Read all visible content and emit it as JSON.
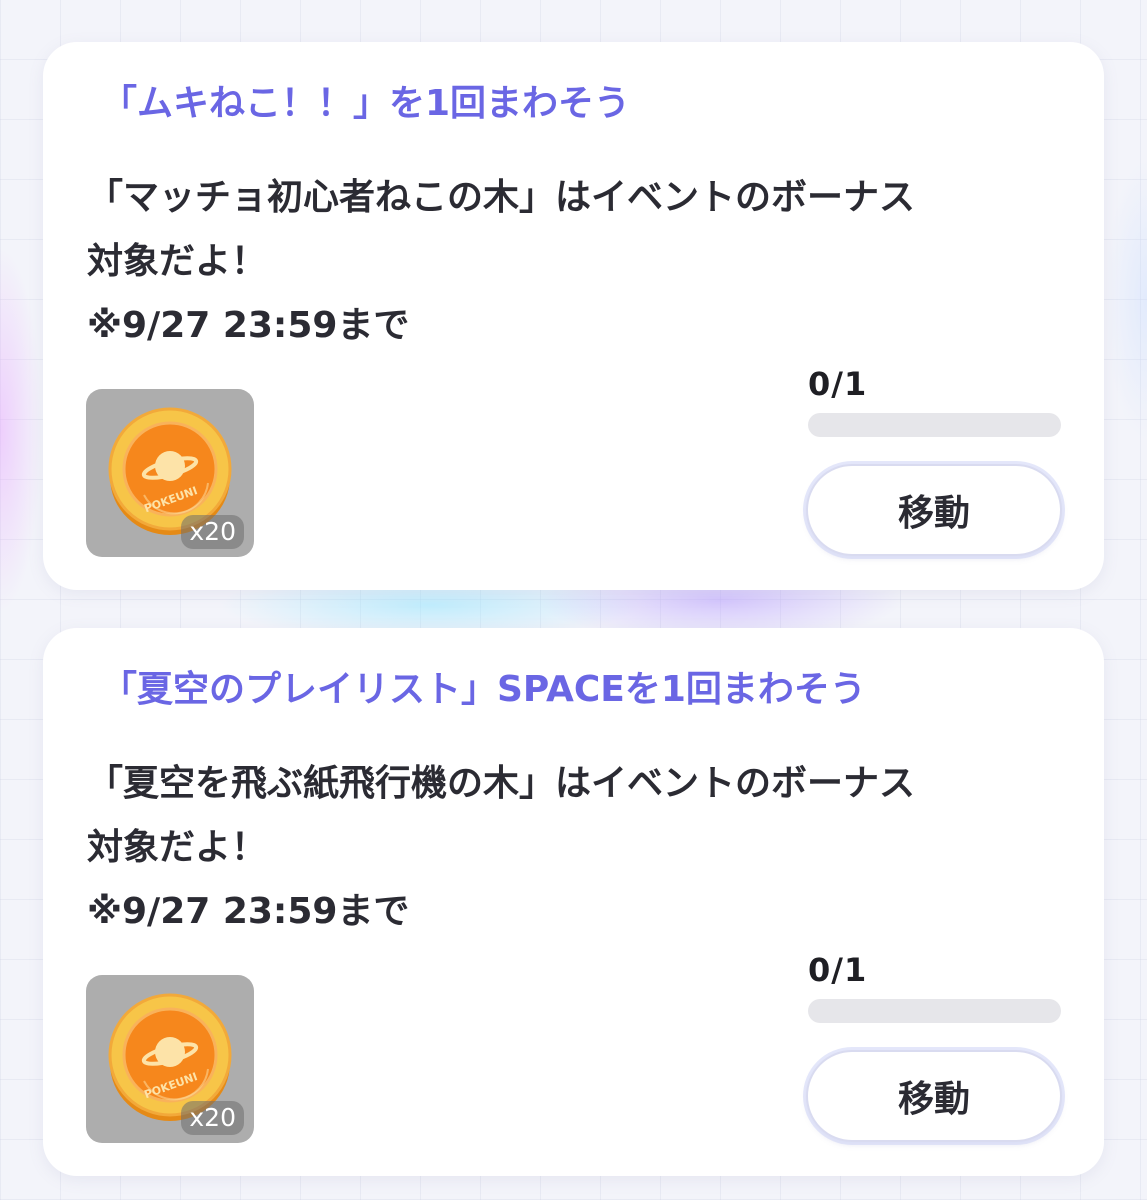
{
  "missions": [
    {
      "title": "「ムキねこ！！」を1回まわそう",
      "description_lines": [
        "「マッチョ初心者ねこの木」はイベントのボーナス",
        "対象だよ！",
        "※9/27 23:59まで"
      ],
      "reward": {
        "icon": "pokeuni-coin-icon",
        "coin_text": "POKEUNI",
        "quantity": "x20"
      },
      "progress_text": "0/1",
      "progress_fraction": 0,
      "button_label": "移動"
    },
    {
      "title": "「夏空のプレイリスト」SPACEを1回まわそう",
      "description_lines": [
        "「夏空を飛ぶ紙飛行機の木」はイベントのボーナス",
        "対象だよ！",
        "※9/27 23:59まで"
      ],
      "reward": {
        "icon": "pokeuni-coin-icon",
        "coin_text": "POKEUNI",
        "quantity": "x20"
      },
      "progress_text": "0/1",
      "progress_fraction": 0,
      "button_label": "移動"
    }
  ],
  "colors": {
    "title": "#6a66e4",
    "text": "#2b2b33",
    "coin_orange": "#f6871c",
    "coin_gold": "#f7c548",
    "tile_gray": "#adadad"
  }
}
